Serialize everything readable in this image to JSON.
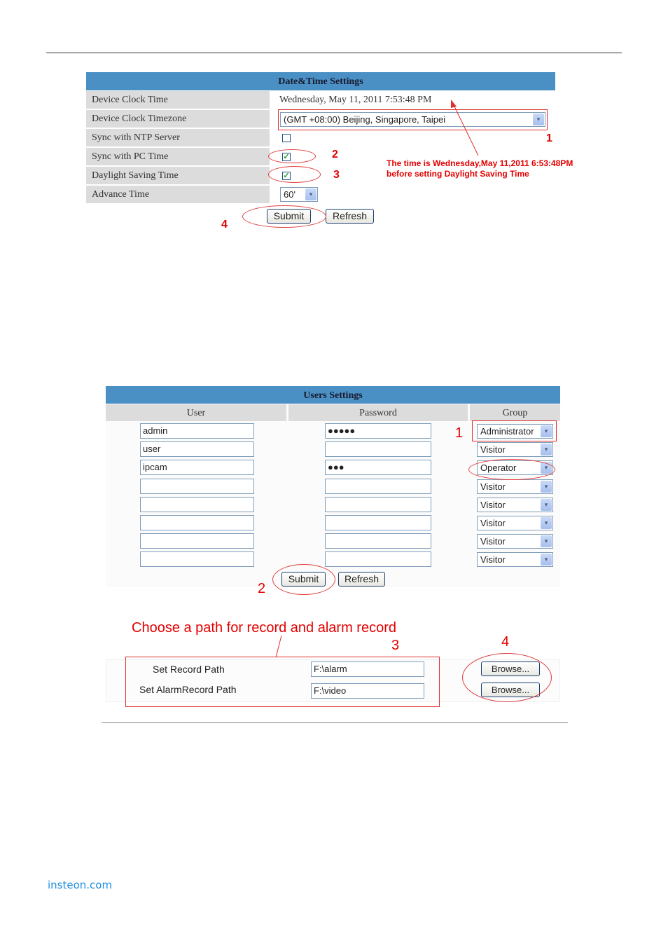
{
  "datetime_settings": {
    "title": "Date&Time Settings",
    "rows": [
      {
        "label": "Device Clock Time",
        "value": "Wednesday, May 11, 2011 7:53:48 PM"
      },
      {
        "label": "Device Clock Timezone",
        "value": "(GMT +08:00) Beijing, Singapore, Taipei"
      },
      {
        "label": "Sync with NTP Server",
        "checked": false
      },
      {
        "label": "Sync with PC Time",
        "checked": true
      },
      {
        "label": "Daylight Saving Time",
        "checked": true
      },
      {
        "label": "Advance Time",
        "value": "60'"
      }
    ],
    "submit_label": "Submit",
    "refresh_label": "Refresh",
    "annotation_note_line1": "The time is Wednesday,May 11,2011 6:53:48PM",
    "annotation_note_line2": "before setting Daylight Saving Time",
    "markers": [
      "1",
      "2",
      "3",
      "4"
    ]
  },
  "users_settings": {
    "title": "Users Settings",
    "columns": [
      "User",
      "Password",
      "Group"
    ],
    "rows": [
      {
        "user": "admin",
        "password": "●●●●●",
        "group": "Administrator"
      },
      {
        "user": "user",
        "password": "",
        "group": "Visitor"
      },
      {
        "user": "ipcam",
        "password": "●●●",
        "group": "Operator"
      },
      {
        "user": "",
        "password": "",
        "group": "Visitor"
      },
      {
        "user": "",
        "password": "",
        "group": "Visitor"
      },
      {
        "user": "",
        "password": "",
        "group": "Visitor"
      },
      {
        "user": "",
        "password": "",
        "group": "Visitor"
      },
      {
        "user": "",
        "password": "",
        "group": "Visitor"
      }
    ],
    "submit_label": "Submit",
    "refresh_label": "Refresh",
    "markers": [
      "1",
      "2"
    ]
  },
  "record_path": {
    "heading": "Choose a path for record and alarm record",
    "rows": [
      {
        "label": "Set Record Path",
        "value": "F:\\alarm",
        "button": "Browse..."
      },
      {
        "label": "Set AlarmRecord Path",
        "value": "F:\\video",
        "button": "Browse..."
      }
    ],
    "markers": [
      "3",
      "4"
    ]
  },
  "icons": {
    "dropdown": "▾",
    "checkmark": "✓"
  },
  "footer": {
    "link_text": "insteon.com"
  }
}
